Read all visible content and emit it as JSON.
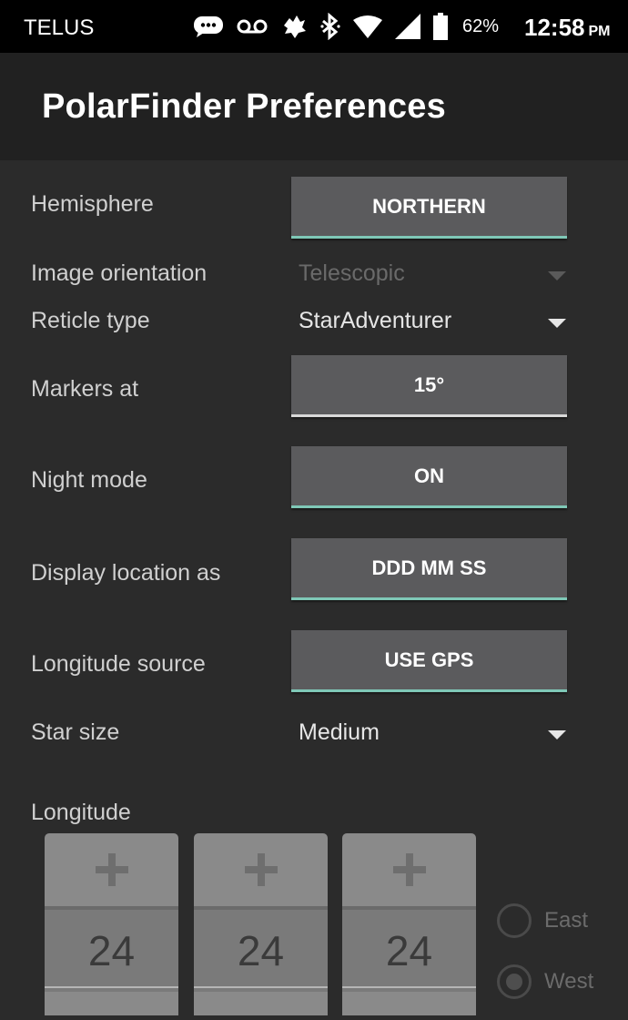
{
  "status_bar": {
    "carrier": "TELUS",
    "battery_percent": "62%",
    "time": "12:58",
    "ampm": "PM",
    "icons": [
      "message-icon",
      "voicemail-icon",
      "android-icon",
      "bluetooth-icon",
      "wifi-icon",
      "signal-icon",
      "battery-icon"
    ]
  },
  "app_bar": {
    "title": "PolarFinder Preferences"
  },
  "prefs": {
    "hemisphere": {
      "label": "Hemisphere",
      "value": "NORTHERN"
    },
    "image_orientation": {
      "label": "Image orientation",
      "value": "Telescopic"
    },
    "reticle_type": {
      "label": "Reticle type",
      "value": "StarAdventurer"
    },
    "markers_at": {
      "label": "Markers at",
      "value": "15°"
    },
    "night_mode": {
      "label": "Night mode",
      "value": "ON"
    },
    "display_location": {
      "label": "Display location as",
      "value": "DDD MM SS"
    },
    "longitude_source": {
      "label": "Longitude source",
      "value": "USE GPS"
    },
    "star_size": {
      "label": "Star size",
      "value": "Medium"
    }
  },
  "longitude": {
    "label": "Longitude",
    "values": [
      "24",
      "24",
      "24"
    ],
    "increment_symbol": "+",
    "directions": {
      "east": "East",
      "west": "West",
      "selected": "West"
    }
  },
  "colors": {
    "accent": "#7fc8b7",
    "button": "#5b5b5d",
    "background": "#2b2b2b",
    "appbar": "#212121"
  }
}
